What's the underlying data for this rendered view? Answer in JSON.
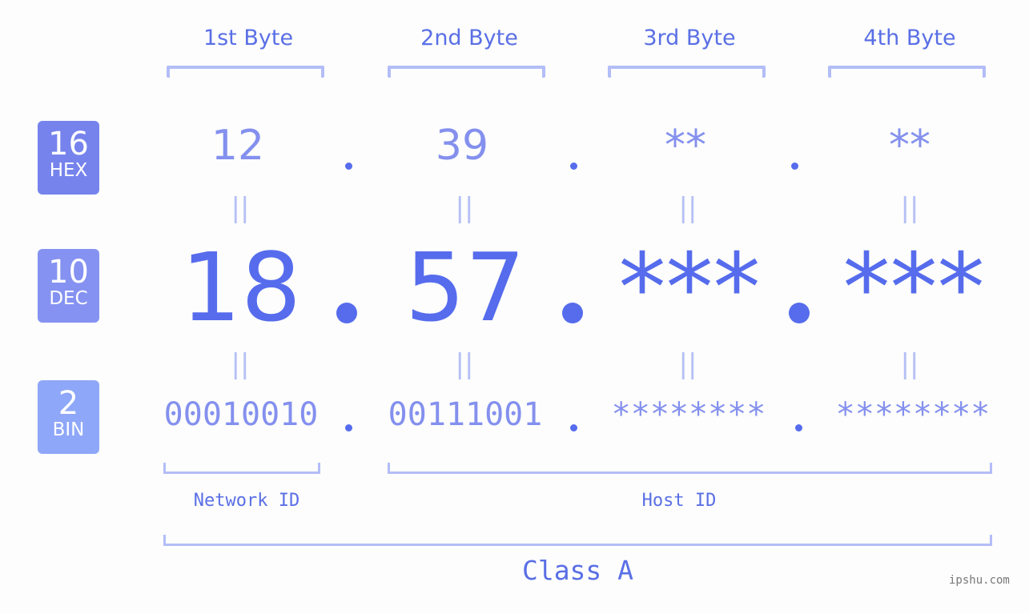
{
  "header": {
    "bytes": [
      "1st Byte",
      "2nd Byte",
      "3rd Byte",
      "4th Byte"
    ]
  },
  "bases": [
    {
      "num": "16",
      "label": "HEX",
      "color": "#7683ed"
    },
    {
      "num": "10",
      "label": "DEC",
      "color": "#8592f1"
    },
    {
      "num": "2",
      "label": "BIN",
      "color": "#8ea7f8"
    }
  ],
  "hex": [
    "12",
    "39",
    "**",
    "**"
  ],
  "dec": [
    "18",
    "57",
    "***",
    "***"
  ],
  "bin": [
    "00010010",
    "00111001",
    "********",
    "********"
  ],
  "separators": {
    "dot": ".",
    "equals": "||"
  },
  "sections": {
    "network": "Network ID",
    "host": "Host ID",
    "class": "Class A"
  },
  "watermark": "ipshu.com",
  "colors": {
    "primary": "#566ced",
    "light": "#8490ee",
    "bracket": "#b3bdf7"
  }
}
